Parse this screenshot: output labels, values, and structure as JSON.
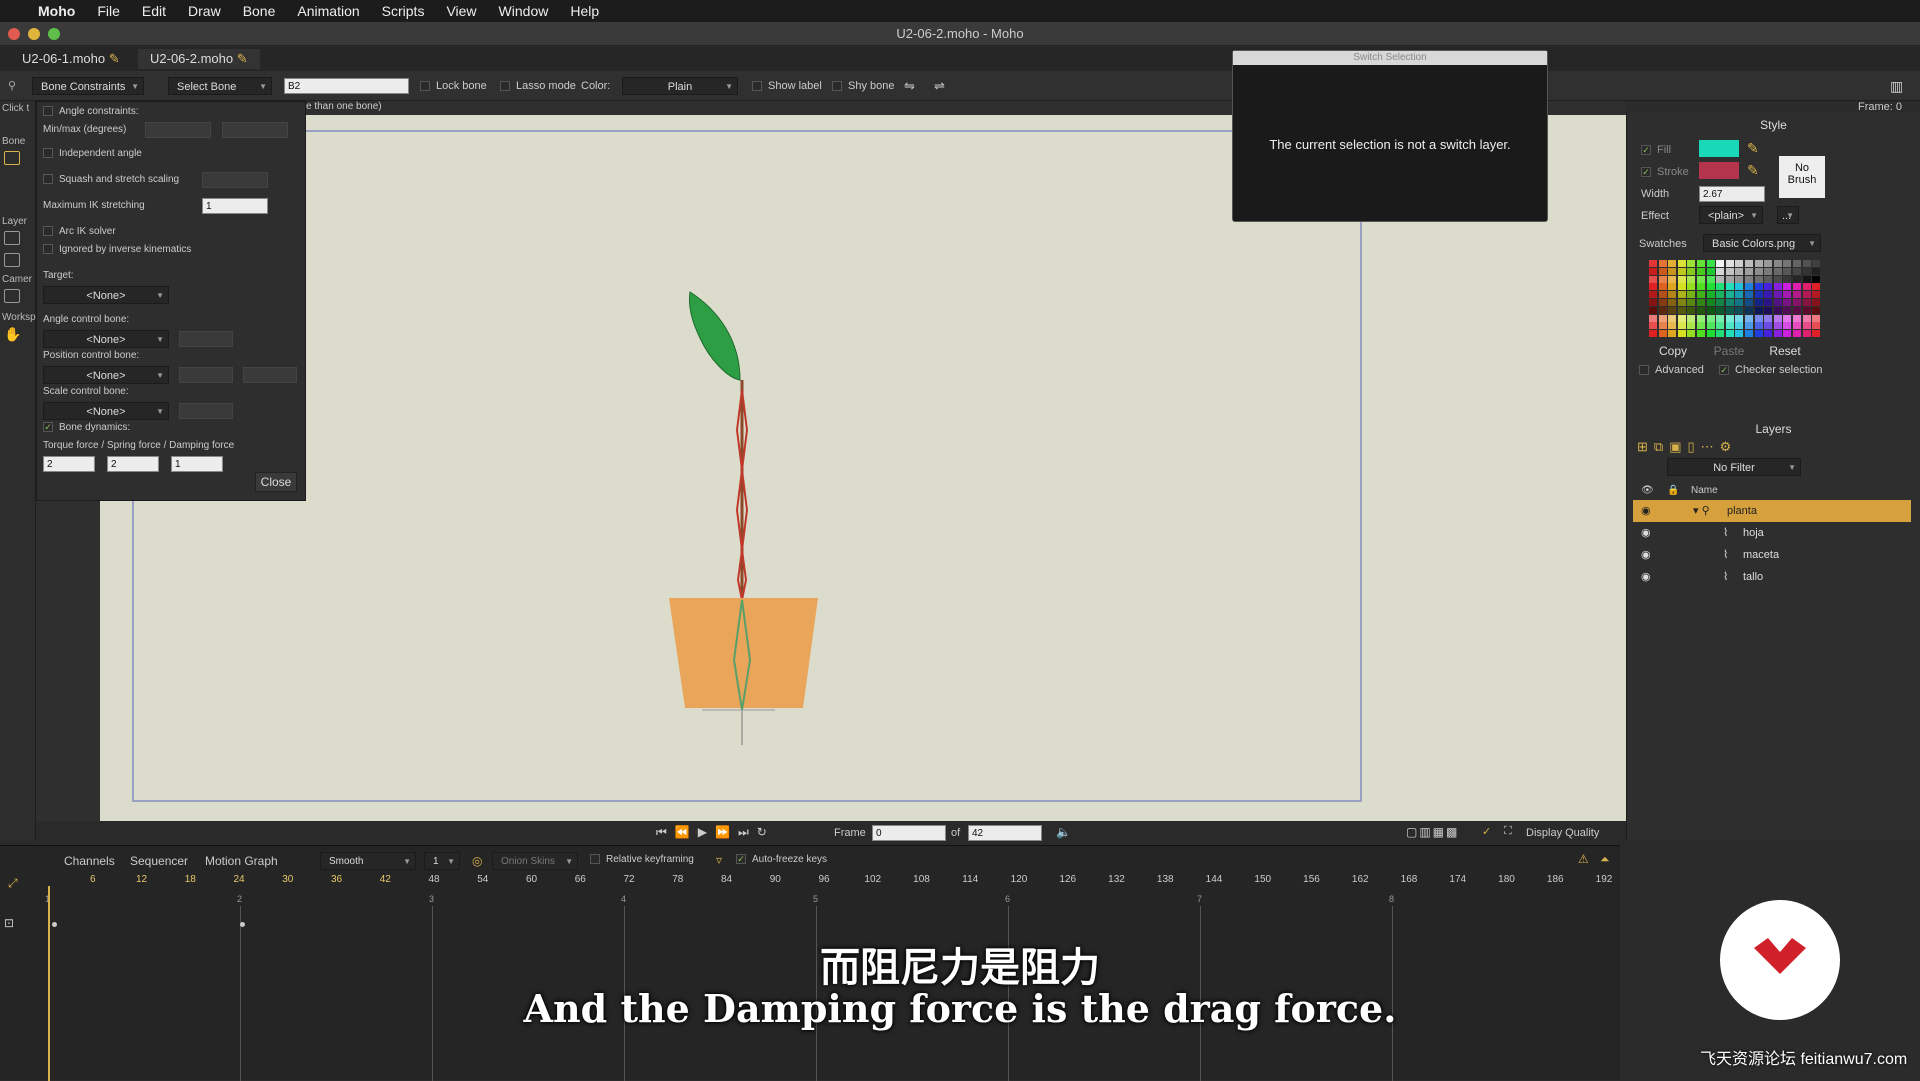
{
  "menubar": {
    "app": "Moho",
    "items": [
      "File",
      "Edit",
      "Draw",
      "Bone",
      "Animation",
      "Scripts",
      "View",
      "Window",
      "Help"
    ]
  },
  "window": {
    "title": "U2-06-2.moho - Moho"
  },
  "tabs": [
    {
      "label": "U2-06-1.moho"
    },
    {
      "label": "U2-06-2.moho"
    }
  ],
  "toolbar": {
    "mode": "Bone Constraints",
    "select_bone": "Select Bone",
    "bone_name": "B2",
    "lock_bone": "Lock bone",
    "lasso_mode": "Lasso mode",
    "color_label": "Color:",
    "color_value": "Plain",
    "show_label": "Show label",
    "shy_bone": "Shy bone",
    "hint": "e than one bone)",
    "click_hint": "Click t"
  },
  "frame_indicator": "Frame: 0",
  "left_tools": {
    "bone": "Bone",
    "layer": "Layer",
    "camera": "Camer",
    "workspace": "Worksp"
  },
  "constraints": {
    "angle_constraints": "Angle constraints:",
    "minmax": "Min/max (degrees)",
    "independent_angle": "Independent angle",
    "squash": "Squash and stretch scaling",
    "max_ik": "Maximum IK stretching",
    "max_ik_value": "1",
    "arc_ik": "Arc IK solver",
    "ignored_ik": "Ignored by inverse kinematics",
    "target": "Target:",
    "target_value": "<None>",
    "angle_control": "Angle control bone:",
    "angle_control_value": "<None>",
    "position_control": "Position control bone:",
    "position_control_value": "<None>",
    "scale_control": "Scale control bone:",
    "scale_control_value": "<None>",
    "bone_dynamics": "Bone dynamics:",
    "forces_label": "Torque force / Spring force / Damping force",
    "torque": "2",
    "spring": "2",
    "damping": "1",
    "close": "Close"
  },
  "switch_dialog": {
    "title": "Switch Selection",
    "message": "The current selection is not a switch layer."
  },
  "style": {
    "title": "Style",
    "fill": "Fill",
    "stroke": "Stroke",
    "fill_color": "#19d8b8",
    "stroke_color": "#b4344e",
    "width_label": "Width",
    "width_value": "2.67",
    "no_brush": "No\nBrush",
    "effect_label": "Effect",
    "effect_value": "<plain>",
    "effect_more": "...",
    "swatches_label": "Swatches",
    "swatches_file": "Basic Colors.png",
    "copy": "Copy",
    "paste": "Paste",
    "reset": "Reset",
    "advanced": "Advanced",
    "checker": "Checker selection"
  },
  "layers": {
    "title": "Layers",
    "filter": "No Filter",
    "name_header": "Name",
    "items": [
      {
        "name": "planta",
        "selected": true
      },
      {
        "name": "hoja",
        "selected": false
      },
      {
        "name": "maceta",
        "selected": false
      },
      {
        "name": "tallo",
        "selected": false
      }
    ]
  },
  "transport": {
    "frame_label": "Frame",
    "frame_value": "0",
    "of_label": "of",
    "total": "42",
    "display_quality": "Display Quality"
  },
  "timeline": {
    "tabs": [
      "Channels",
      "Sequencer",
      "Motion Graph"
    ],
    "interp": "Smooth",
    "interp_num": "1",
    "onion": "Onion Skins",
    "relative": "Relative keyframing",
    "autofreeze": "Auto-freeze keys",
    "ticks": [
      "6",
      "12",
      "18",
      "24",
      "30",
      "36",
      "42",
      "48",
      "54",
      "60",
      "66",
      "72",
      "78",
      "84",
      "90",
      "96",
      "102",
      "108",
      "114",
      "120",
      "126",
      "132",
      "138",
      "144",
      "150",
      "156",
      "162",
      "168",
      "174",
      "180",
      "186",
      "192"
    ],
    "sub_ticks": [
      "1",
      "2",
      "3",
      "4",
      "5",
      "6",
      "7",
      "8"
    ]
  },
  "subtitles": {
    "cn": "而阻尼力是阻力",
    "en": "And the Damping force is the drag force."
  },
  "watermark": "飞天资源论坛 feitianwu7.com"
}
